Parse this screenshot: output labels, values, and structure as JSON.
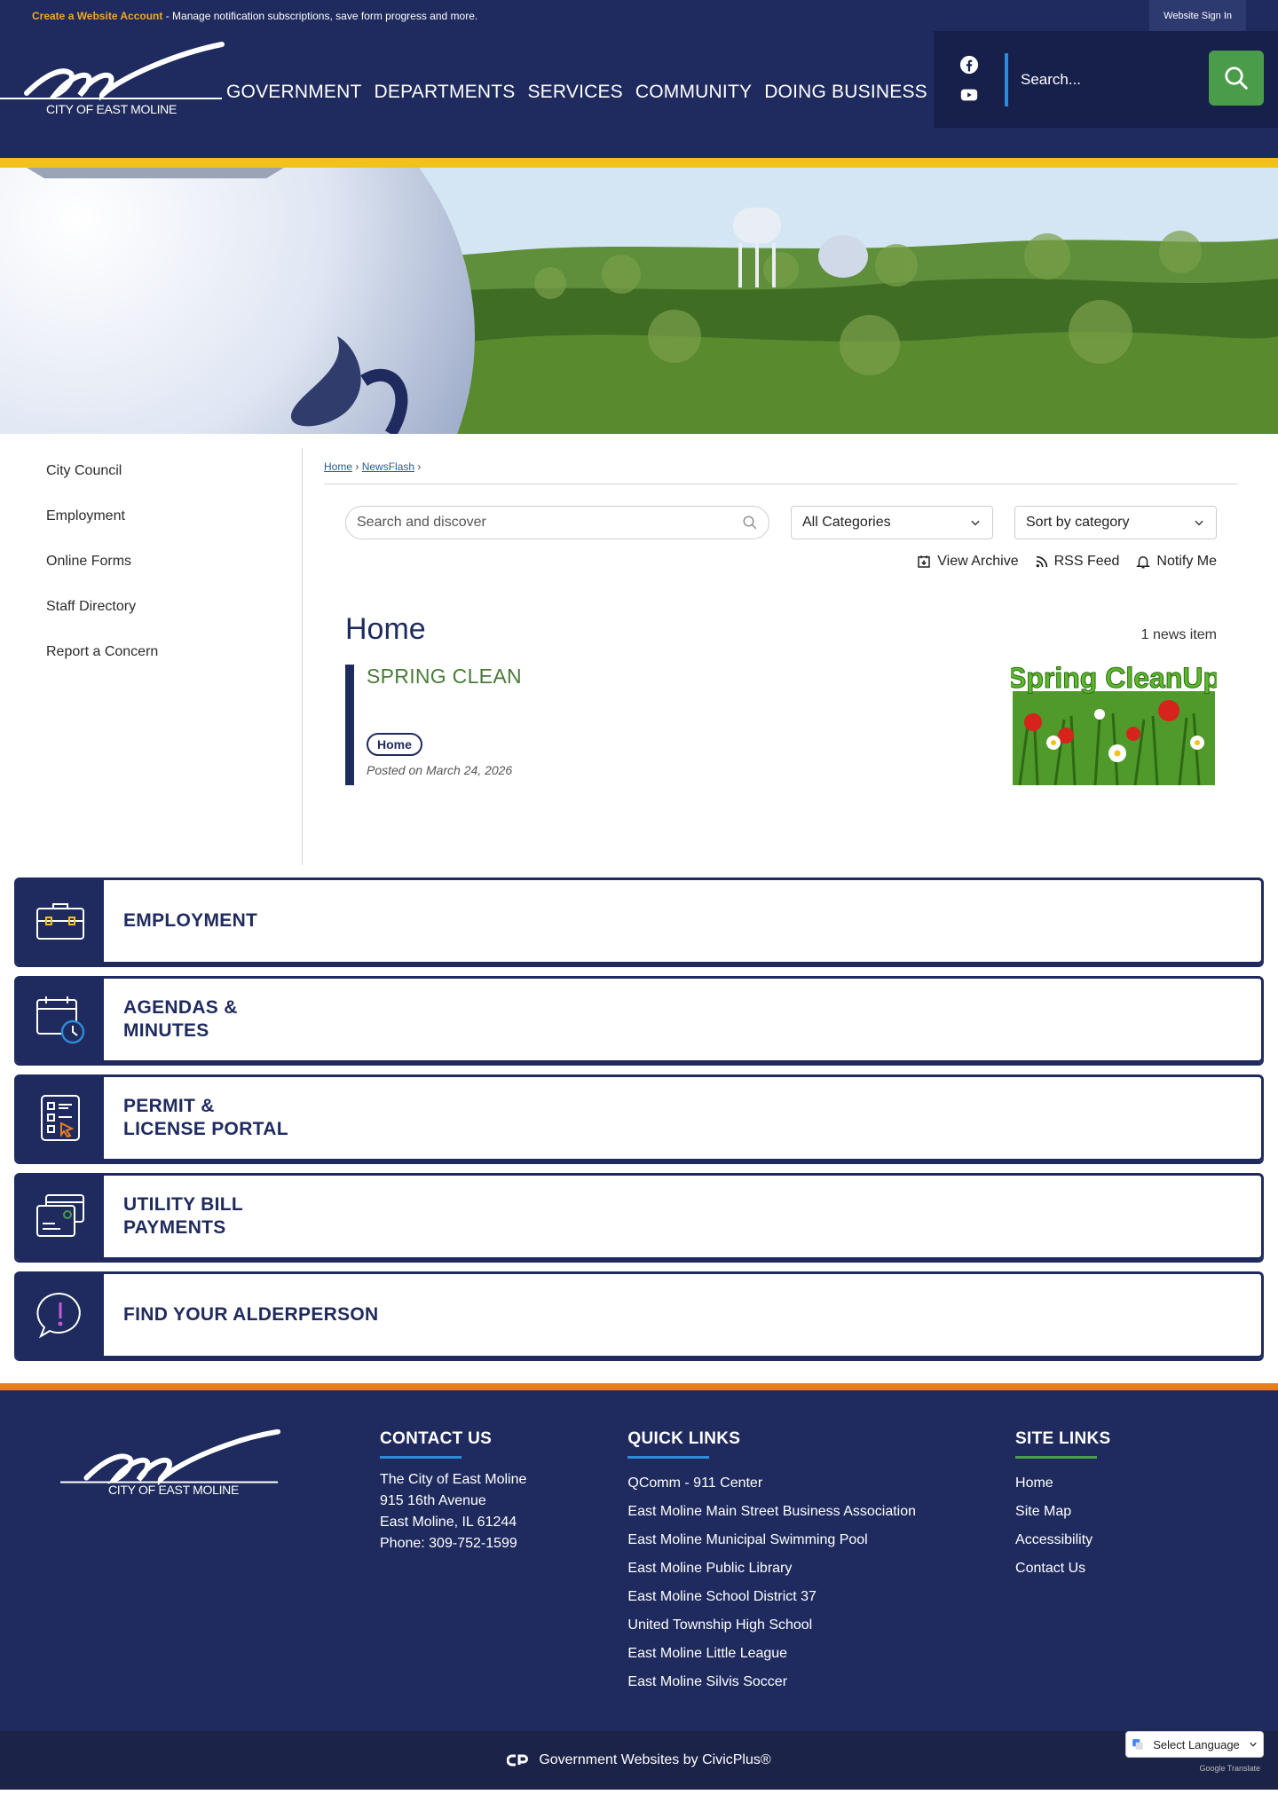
{
  "topbar": {
    "create_account": "Create a Website Account",
    "create_desc": " - Manage notification subscriptions, save form progress and more.",
    "sign_in": "Website Sign In"
  },
  "header": {
    "logo_text": "CITY OF EAST MOLINE",
    "nav": [
      "GOVERNMENT",
      "DEPARTMENTS",
      "SERVICES",
      "COMMUNITY",
      "DOING BUSINESS"
    ],
    "search_placeholder": "Search..."
  },
  "sidebar": {
    "items": [
      "City Council",
      "Employment",
      "Online Forms",
      "Staff Directory",
      "Report a Concern"
    ]
  },
  "breadcrumb": {
    "home": "Home",
    "newsflash": "NewsFlash"
  },
  "filters": {
    "search_placeholder": "Search and discover",
    "category": "All Categories",
    "sort": "Sort by category"
  },
  "actions": {
    "archive": "View Archive",
    "rss": "RSS Feed",
    "notify": "Notify Me"
  },
  "news": {
    "heading": "Home",
    "count": "1 news item",
    "items": [
      {
        "title": "SPRING CLEAN",
        "tag": "Home",
        "posted": "Posted on March 24, 2026",
        "image_caption": "Spring CleanUp"
      }
    ]
  },
  "tiles": [
    {
      "label": "EMPLOYMENT",
      "icon": "briefcase-icon"
    },
    {
      "label": "AGENDAS &\nMINUTES",
      "icon": "calendar-clock-icon"
    },
    {
      "label": "PERMIT &\nLICENSE PORTAL",
      "icon": "checklist-icon"
    },
    {
      "label": "UTILITY BILL\nPAYMENTS",
      "icon": "bill-payment-icon"
    },
    {
      "label": "FIND YOUR ALDERPERSON",
      "icon": "speech-alert-icon"
    }
  ],
  "footer": {
    "logo_text": "CITY OF EAST MOLINE",
    "contact": {
      "heading": "CONTACT US",
      "lines": [
        "The City of East Moline",
        "915 16th Avenue",
        "East Moline, IL 61244",
        "Phone: 309-752-1599"
      ]
    },
    "quick_links": {
      "heading": "QUICK LINKS",
      "links": [
        "QComm - 911 Center",
        "East Moline Main Street Business Association",
        "East Moline Municipal Swimming Pool",
        "East Moline Public Library",
        "East Moline School District 37",
        "United Township High School",
        "East Moline Little League",
        "East Moline Silvis Soccer"
      ]
    },
    "site_links": {
      "heading": "SITE LINKS",
      "links": [
        "Home",
        "Site Map",
        "Accessibility",
        "Contact Us"
      ]
    },
    "credit": "Government Websites by CivicPlus®",
    "translate_label": "Select Language",
    "translate_powered": "Google Translate"
  },
  "colors": {
    "navy": "#1f2b5e",
    "gold": "#f2c21a",
    "orange": "#e87d22",
    "green": "#4a9b4a",
    "blue_accent": "#2e8bd8"
  }
}
